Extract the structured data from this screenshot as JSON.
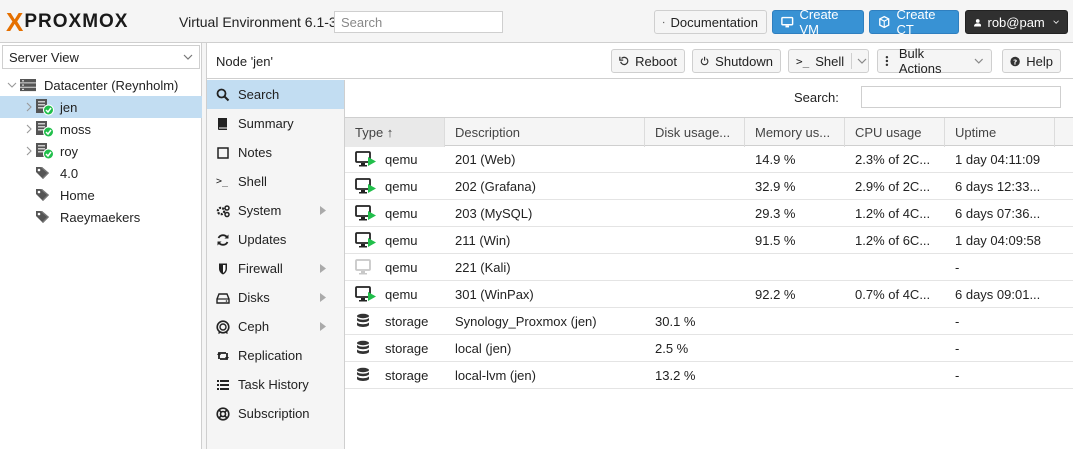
{
  "header": {
    "logo_x": "X",
    "logo_text": "PROXMOX",
    "version": "Virtual Environment 6.1-3",
    "search_placeholder": "Search",
    "documentation_label": "Documentation",
    "create_vm_label": "Create VM",
    "create_ct_label": "Create CT",
    "user_label": "rob@pam"
  },
  "sidebar": {
    "view_label": "Server View",
    "tree": [
      {
        "label": "Datacenter (Reynholm)",
        "icon": "datacenter-icon",
        "level": 0,
        "expanded": true
      },
      {
        "label": "jen",
        "icon": "node-online-icon",
        "level": 1,
        "selected": true
      },
      {
        "label": "moss",
        "icon": "node-online-icon",
        "level": 1
      },
      {
        "label": "roy",
        "icon": "node-online-icon",
        "level": 1
      },
      {
        "label": "4.0",
        "icon": "tag-icon",
        "level": 1
      },
      {
        "label": "Home",
        "icon": "tag-icon",
        "level": 1
      },
      {
        "label": "Raeymaekers",
        "icon": "tag-icon",
        "level": 1
      }
    ]
  },
  "content": {
    "title": "Node 'jen'",
    "buttons": {
      "reboot": "Reboot",
      "shutdown": "Shutdown",
      "shell": "Shell",
      "bulk_actions": "Bulk Actions",
      "help": "Help"
    }
  },
  "menu": [
    {
      "label": "Search",
      "icon": "search-icon",
      "active": true
    },
    {
      "label": "Summary",
      "icon": "book-icon"
    },
    {
      "label": "Notes",
      "icon": "notes-icon"
    },
    {
      "label": "Shell",
      "icon": "terminal-icon"
    },
    {
      "label": "System",
      "icon": "gears-icon",
      "submenu": true
    },
    {
      "label": "Updates",
      "icon": "refresh-icon"
    },
    {
      "label": "Firewall",
      "icon": "shield-icon",
      "submenu": true
    },
    {
      "label": "Disks",
      "icon": "hdd-icon",
      "submenu": true
    },
    {
      "label": "Ceph",
      "icon": "ceph-icon",
      "submenu": true
    },
    {
      "label": "Replication",
      "icon": "retweet-icon"
    },
    {
      "label": "Task History",
      "icon": "list-icon"
    },
    {
      "label": "Subscription",
      "icon": "support-icon"
    }
  ],
  "grid": {
    "search_label": "Search:",
    "columns": [
      "Type ↑",
      "Description",
      "Disk usage...",
      "Memory us...",
      "CPU usage",
      "Uptime"
    ],
    "rows": [
      {
        "type": "qemu",
        "icon": "vm-running-icon",
        "description": "201 (Web)",
        "disk": "",
        "memory": "14.9 %",
        "cpu": "2.3% of 2C...",
        "uptime": "1 day 04:11:09"
      },
      {
        "type": "qemu",
        "icon": "vm-running-icon",
        "description": "202 (Grafana)",
        "disk": "",
        "memory": "32.9 %",
        "cpu": "2.9% of 2C...",
        "uptime": "6 days 12:33..."
      },
      {
        "type": "qemu",
        "icon": "vm-running-icon",
        "description": "203 (MySQL)",
        "disk": "",
        "memory": "29.3 %",
        "cpu": "1.2% of 4C...",
        "uptime": "6 days 07:36..."
      },
      {
        "type": "qemu",
        "icon": "vm-running-icon",
        "description": "211 (Win)",
        "disk": "",
        "memory": "91.5 %",
        "cpu": "1.2% of 6C...",
        "uptime": "1 day 04:09:58"
      },
      {
        "type": "qemu",
        "icon": "vm-stopped-icon",
        "description": "221 (Kali)",
        "disk": "",
        "memory": "",
        "cpu": "",
        "uptime": "-"
      },
      {
        "type": "qemu",
        "icon": "vm-running-icon",
        "description": "301 (WinPax)",
        "disk": "",
        "memory": "92.2 %",
        "cpu": "0.7% of 4C...",
        "uptime": "6 days 09:01..."
      },
      {
        "type": "storage",
        "icon": "storage-icon",
        "description": "Synology_Proxmox (jen)",
        "disk": "30.1 %",
        "memory": "",
        "cpu": "",
        "uptime": "-"
      },
      {
        "type": "storage",
        "icon": "storage-icon",
        "description": "local (jen)",
        "disk": "2.5 %",
        "memory": "",
        "cpu": "",
        "uptime": "-"
      },
      {
        "type": "storage",
        "icon": "storage-icon",
        "description": "local-lvm (jen)",
        "disk": "13.2 %",
        "memory": "",
        "cpu": "",
        "uptime": "-"
      }
    ]
  },
  "colors": {
    "accent": "#3892d4",
    "selected": "#c2ddf2",
    "running": "#21bf4b",
    "brand_orange": "#e57000",
    "user_button": "#303030"
  }
}
